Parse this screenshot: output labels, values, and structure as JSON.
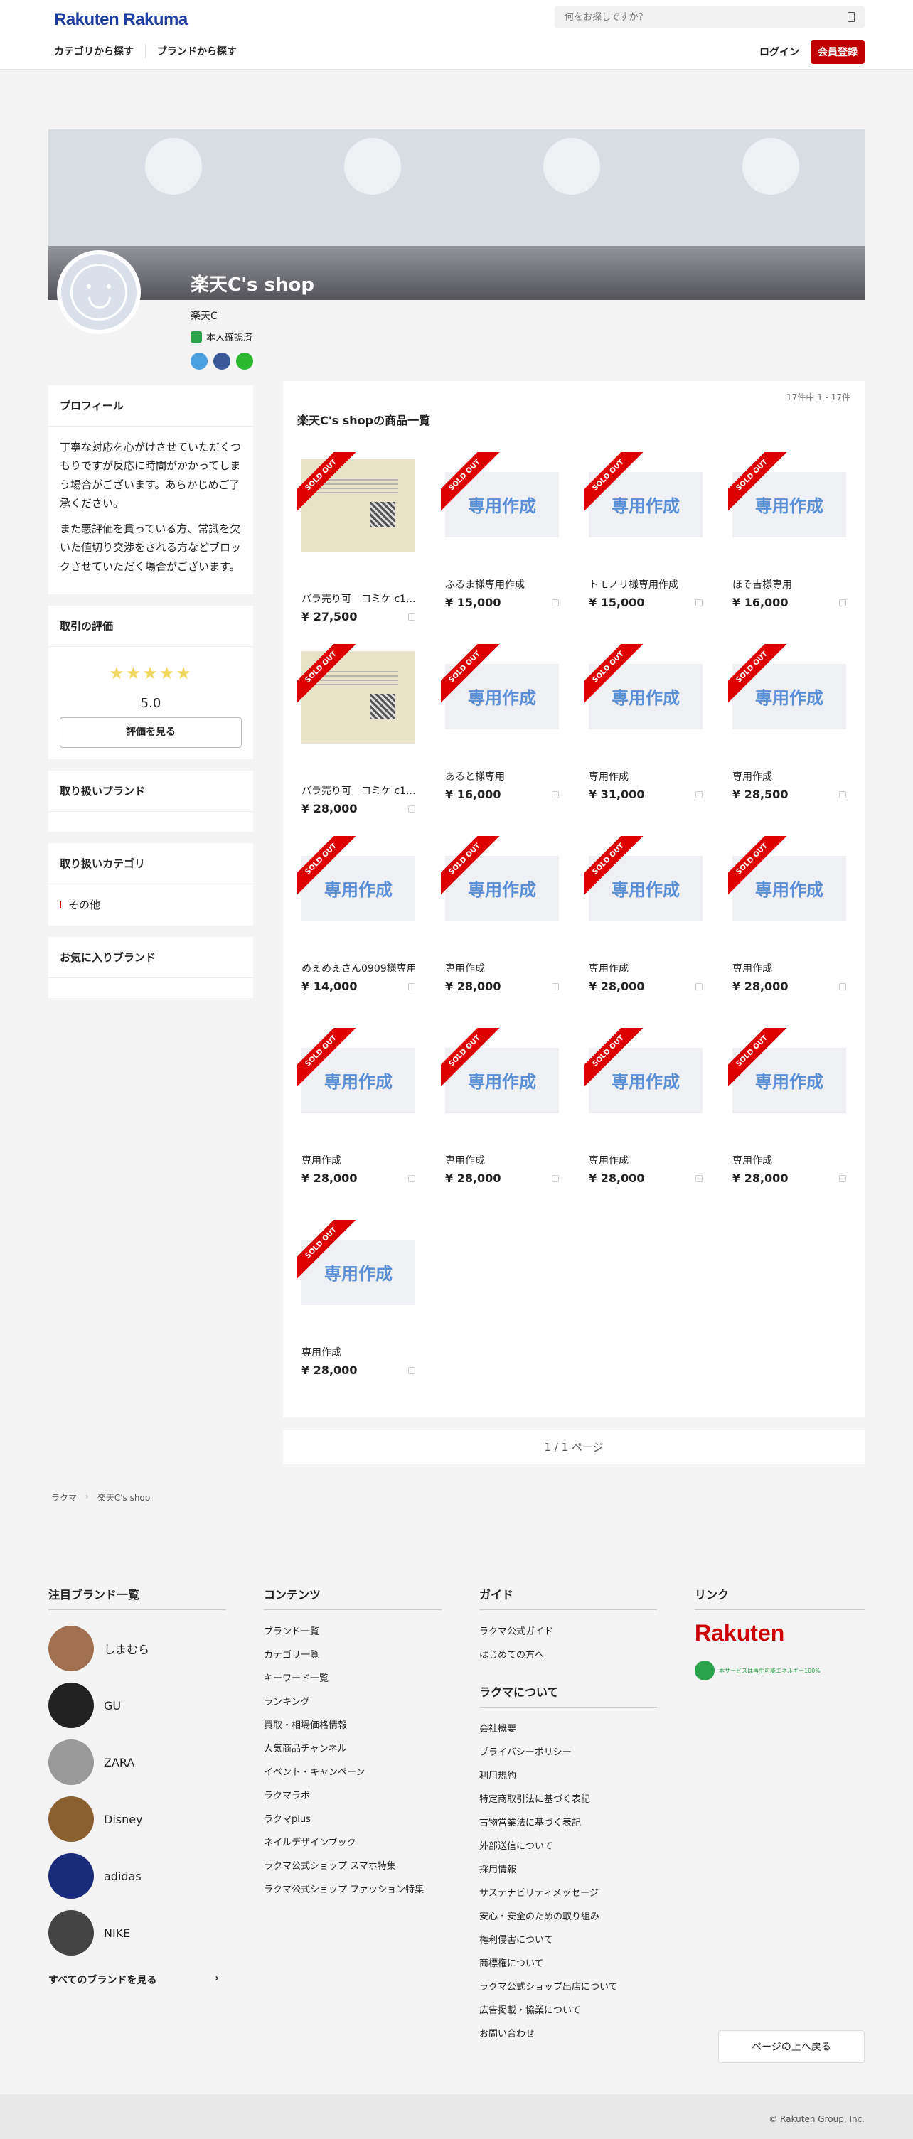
{
  "header": {
    "logo": "Rakuten Rakuma",
    "search_placeholder": "何をお探しですか？",
    "nav": [
      "カテゴリから探す",
      "ブランドから探す"
    ],
    "login": "ログイン",
    "register": "会員登録"
  },
  "profile": {
    "shop_name": "楽天C's shop",
    "owner": "楽天C",
    "verified": "本人確認済"
  },
  "sidebar": {
    "profile_title": "プロフィール",
    "profile_text_1": "丁寧な対応を心がけさせていただくつもりですが反応に時間がかかってしまう場合がございます。あらかじめご了承ください。",
    "profile_text_2": "また悪評価を貫っている方、常識を欠いた値切り交渉をされる方などブロックさせていただく場合がございます。",
    "rating_title": "取引の評価",
    "stars": "★★★★★",
    "rating_value": "5.0",
    "rating_button": "評価を見る",
    "brands_title": "取り扱いブランド",
    "categories_title": "取り扱いカテゴリ",
    "category_item": "その他",
    "fav_brands_title": "お気に入りブランド"
  },
  "listing": {
    "count": "17件中 1 - 17件",
    "title": "楽天C's shopの商品一覧",
    "sold_label": "SOLD OUT",
    "custom_label": "専用作成",
    "items": [
      {
        "name": "バラ売り可　コミケ c1...",
        "price": "¥ 27,500",
        "photo": true
      },
      {
        "name": "ふるま様専用作成",
        "price": "¥ 15,000",
        "photo": false
      },
      {
        "name": "トモノリ様専用作成",
        "price": "¥ 15,000",
        "photo": false
      },
      {
        "name": "ほそ吉様専用",
        "price": "¥ 16,000",
        "photo": false
      },
      {
        "name": "バラ売り可　コミケ c1...",
        "price": "¥ 28,000",
        "photo": true
      },
      {
        "name": "あると様専用",
        "price": "¥ 16,000",
        "photo": false
      },
      {
        "name": "専用作成",
        "price": "¥ 31,000",
        "photo": false
      },
      {
        "name": "専用作成",
        "price": "¥ 28,500",
        "photo": false
      },
      {
        "name": "めぇめぇさん0909様専用",
        "price": "¥ 14,000",
        "photo": false
      },
      {
        "name": "専用作成",
        "price": "¥ 28,000",
        "photo": false
      },
      {
        "name": "専用作成",
        "price": "¥ 28,000",
        "photo": false
      },
      {
        "name": "専用作成",
        "price": "¥ 28,000",
        "photo": false
      },
      {
        "name": "専用作成",
        "price": "¥ 28,000",
        "photo": false
      },
      {
        "name": "専用作成",
        "price": "¥ 28,000",
        "photo": false
      },
      {
        "name": "専用作成",
        "price": "¥ 28,000",
        "photo": false
      },
      {
        "name": "専用作成",
        "price": "¥ 28,000",
        "photo": false
      },
      {
        "name": "専用作成",
        "price": "¥ 28,000",
        "photo": false
      }
    ]
  },
  "pager": "1 / 1 ページ",
  "breadcrumb": [
    "ラクマ",
    "楽天C's shop"
  ],
  "footer": {
    "brands_title": "注目ブランド一覧",
    "brands": [
      "しまむら",
      "GU",
      "ZARA",
      "Disney",
      "adidas",
      "NIKE"
    ],
    "all_brands": "すべてのブランドを見る",
    "contents_title": "コンテンツ",
    "contents": [
      "ブランド一覧",
      "カテゴリ一覧",
      "キーワード一覧",
      "ランキング",
      "買取・相場価格情報",
      "人気商品チャンネル",
      "イベント・キャンペーン",
      "ラクマラボ",
      "ラクマplus",
      "ネイルデザインブック",
      "ラクマ公式ショップ スマホ特集",
      "ラクマ公式ショップ ファッション特集"
    ],
    "guide_title": "ガイド",
    "guide": [
      "ラクマ公式ガイド",
      "はじめての方へ"
    ],
    "about_title": "ラクマについて",
    "about": [
      "会社概要",
      "プライバシーポリシー",
      "利用規約",
      "特定商取引法に基づく表記",
      "古物営業法に基づく表記",
      "外部送信について",
      "採用情報",
      "サステナビリティメッセージ",
      "安心・安全のための取り組み",
      "権利侵害について",
      "商標権について",
      "ラクマ公式ショップ出店について",
      "広告掲載・協業について",
      "お問い合わせ"
    ],
    "links_title": "リンク",
    "rakuten_logo": "Rakuten",
    "green_text": "本サービスは再生可能エネルギー100%",
    "to_top": "ページの上へ戻る",
    "copyright": "© Rakuten Group, Inc."
  }
}
